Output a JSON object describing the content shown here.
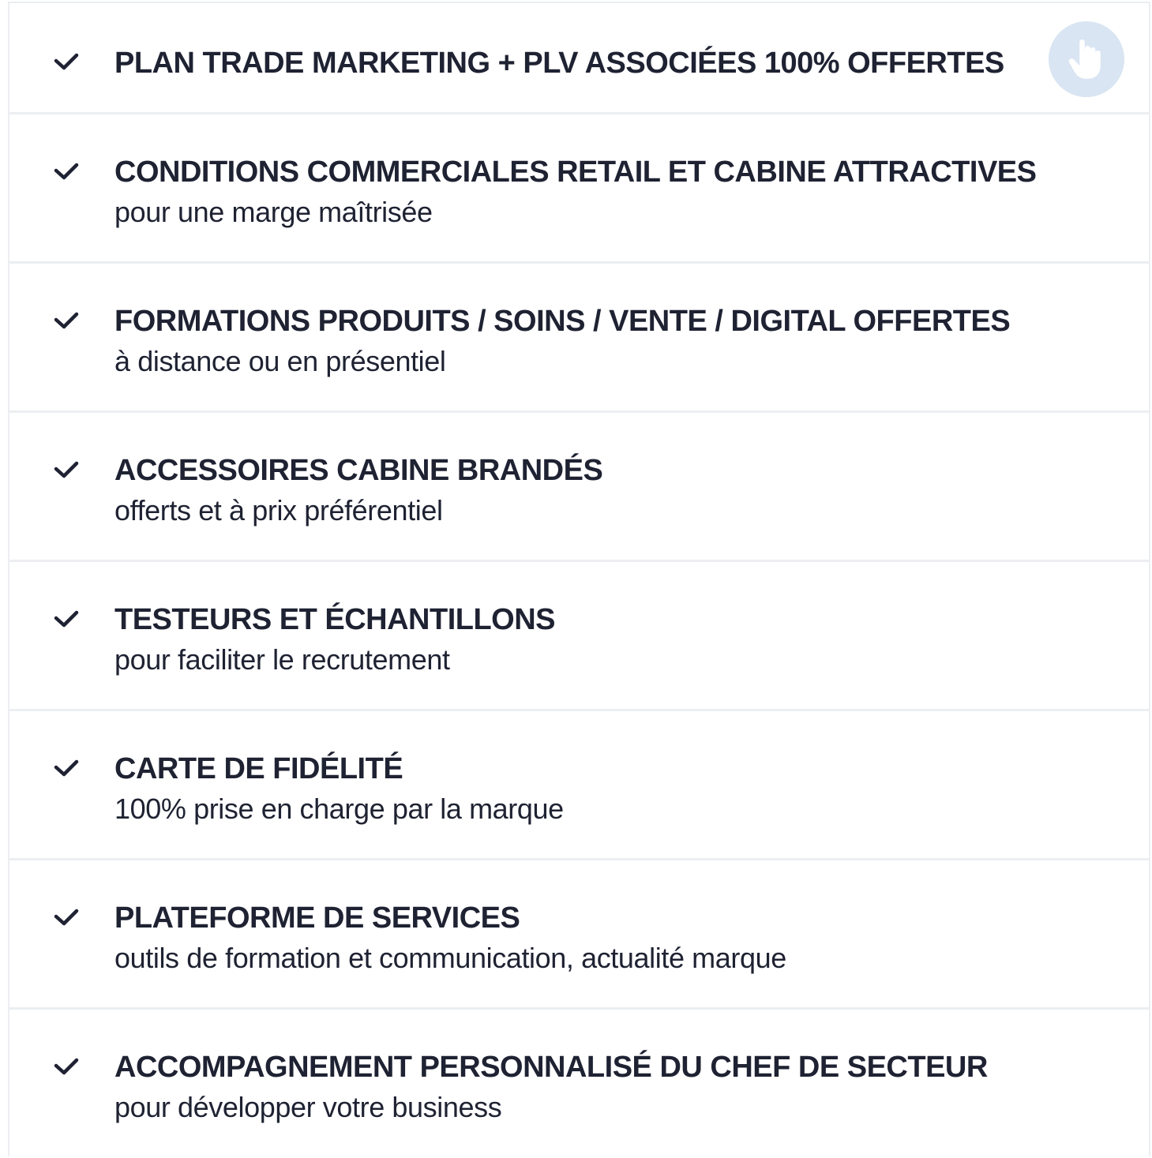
{
  "benefits": [
    {
      "title": "PLAN TRADE MARKETING + PLV ASSOCIÉES 100% OFFERTES",
      "subtitle": ""
    },
    {
      "title": "CONDITIONS COMMERCIALES RETAIL ET CABINE ATTRACTIVES",
      "subtitle": "pour une marge maîtrisée"
    },
    {
      "title": "FORMATIONS PRODUITS / SOINS / VENTE / DIGITAL OFFERTES",
      "subtitle": "à distance ou en présentiel"
    },
    {
      "title": "ACCESSOIRES CABINE BRANDÉS",
      "subtitle": "offerts et à prix préférentiel"
    },
    {
      "title": "TESTEURS ET ÉCHANTILLONS",
      "subtitle": "pour faciliter le recrutement"
    },
    {
      "title": "CARTE DE FIDÉLITÉ",
      "subtitle": "100% prise en charge par la marque"
    },
    {
      "title": "PLATEFORME DE SERVICES",
      "subtitle": "outils de formation et communication, actualité marque"
    },
    {
      "title": "ACCOMPAGNEMENT PERSONNALISÉ DU CHEF DE SECTEUR",
      "subtitle": "pour développer votre business"
    }
  ],
  "icons": {
    "row_icon": "check-icon",
    "floating_button_icon": "pointing-hand-icon"
  },
  "colors": {
    "text": "#1e2232",
    "divider": "#eceef1",
    "hand_button_bg": "#d9e5f2",
    "hand_icon": "#ffffff"
  }
}
